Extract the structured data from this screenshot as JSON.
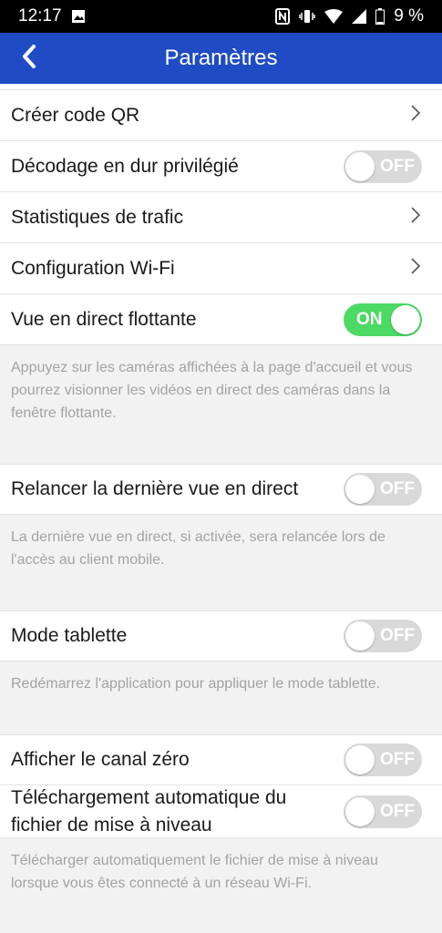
{
  "status_bar": {
    "time": "12:17",
    "battery": "9 %",
    "icons": [
      "image-icon",
      "nfc-icon",
      "vibrate-icon",
      "wifi-icon",
      "signal-icon",
      "battery-icon"
    ]
  },
  "header": {
    "title": "Paramètres",
    "back_icon": "chevron-left-icon",
    "color": "#1f4cc5"
  },
  "settings": {
    "qr": {
      "label": "Créer code QR"
    },
    "hw_decode": {
      "label": "Décodage en dur privilégié",
      "state": "OFF"
    },
    "traffic": {
      "label": "Statistiques de trafic"
    },
    "wifi": {
      "label": "Configuration Wi-Fi"
    },
    "floating": {
      "label": "Vue en direct flottante",
      "state": "ON",
      "desc": "Appuyez sur les caméras affichées à la page d'accueil et vous pourrez visionner les vidéos en direct des caméras dans la fenêtre flottante."
    },
    "relaunch": {
      "label": "Relancer la dernière vue en direct",
      "state": "OFF",
      "desc": "La dernière vue en direct, si activée, sera relancée lors de l'accès au client mobile."
    },
    "tablet": {
      "label": "Mode tablette",
      "state": "OFF",
      "desc": "Redémarrez l'application pour appliquer le mode tablette."
    },
    "zero_channel": {
      "label": "Afficher le canal zéro",
      "state": "OFF"
    },
    "auto_download": {
      "label_line1": "Téléchargement automatique du",
      "label_line2": "fichier de mise à niveau",
      "state": "OFF",
      "desc": "Télécharger automatiquement le fichier de mise à niveau lorsque vous êtes connecté à un réseau Wi-Fi."
    }
  },
  "colors": {
    "toggle_on": "#4cd964",
    "toggle_off": "#d9d9d9"
  }
}
